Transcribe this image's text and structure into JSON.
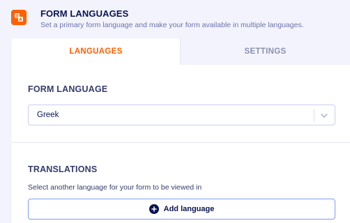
{
  "header": {
    "icon": "translate-icon",
    "title": "FORM LANGUAGES",
    "subtitle": "Set a primary form language and make your form available in multiple languages."
  },
  "tabs": [
    {
      "label": "LANGUAGES",
      "active": true
    },
    {
      "label": "SETTINGS",
      "active": false
    }
  ],
  "form_language": {
    "label": "FORM LANGUAGE",
    "selected": "Greek"
  },
  "translations": {
    "label": "TRANSLATIONS",
    "description": "Select another language for your form to be viewed in",
    "add_button_label": "Add language"
  },
  "colors": {
    "accent": "#ff6100",
    "navy": "#0a1551",
    "background": "#f3f3fe",
    "button_border": "#7e9cf5"
  }
}
